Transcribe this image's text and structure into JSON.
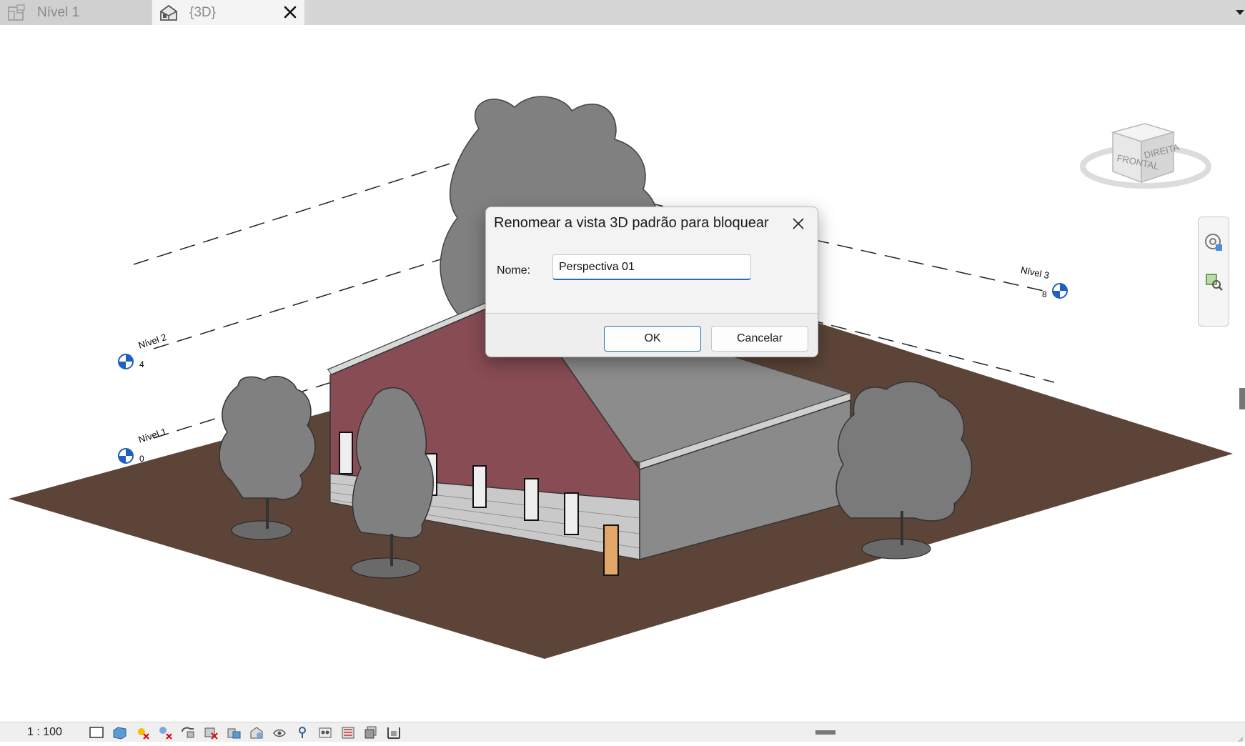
{
  "tabs": [
    {
      "label": "Nível 1",
      "icon": "floor-plan-icon",
      "active": false
    },
    {
      "label": "{3D}",
      "icon": "3d-house-icon",
      "active": true
    }
  ],
  "viewport": {
    "levels": [
      {
        "name": "Nível 3",
        "elevation": "8"
      },
      {
        "name": "Nível 2",
        "elevation": "4"
      },
      {
        "name": "Nível 1",
        "elevation": "0"
      }
    ],
    "viewcube": {
      "front": "FRONTAL",
      "right": "DIREITA"
    },
    "colors": {
      "ground": "#5c4538",
      "wall": "#874c54",
      "roof": "#8a8a8a",
      "trees": "#7a7a7a",
      "level_marker": "#1f5fbf"
    }
  },
  "dialog": {
    "title": "Renomear a vista 3D padrão para bloquear",
    "name_label": "Nome:",
    "name_value": "Perspectiva 01",
    "ok_label": "OK",
    "cancel_label": "Cancelar"
  },
  "status": {
    "scale": "1 : 100",
    "icons": [
      "detail-level-icon",
      "visual-style-icon",
      "sun-path-icon",
      "shadows-icon",
      "crop-view-icon",
      "show-crop-icon",
      "unlocked-3d-view-icon",
      "temporary-hide-icon",
      "reveal-hidden-icon",
      "analytical-model-icon",
      "highlight-displacement-icon",
      "temporary-view-properties-icon",
      "worksharing-icon",
      "hidden-elements-icon",
      "constraints-icon"
    ]
  }
}
